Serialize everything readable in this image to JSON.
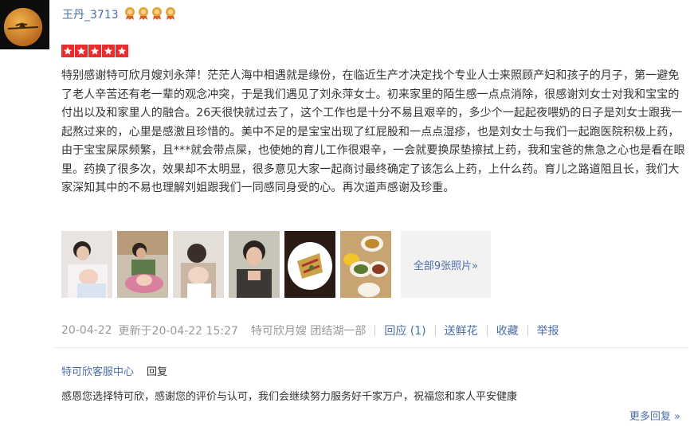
{
  "user": {
    "name": "王丹_3713",
    "badge_count": 4
  },
  "rating": {
    "stars": 5,
    "max": 5
  },
  "review": {
    "text": "特别感谢特可欣月嫂刘永萍！茫茫人海中相遇就是缘份，在临近生产才决定找个专业人士来照顾产妇和孩子的月子，第一避免了老人辛苦还有老一辈的观念冲突，于是我们遇见了刘永萍女士。初来家里的陌生感一点点消除，很感谢刘女士对我和宝宝的付出以及和家里人的融合。26天很快就过去了，这个工作也是十分不易且艰辛的，多少个一起起夜喂奶的日子是刘女士跟我一起熬过来的，心里是感激且珍惜的。美中不足的是宝宝出现了红屁股和一点点湿疹，也是刘女士与我们一起跑医院积极上药，由于宝宝屎尿频繁，且***就会带点屎，也使她的育儿工作很艰辛，一会就要换尿垫擦拭上药，我和宝爸的焦急之心也是看在眼里。药换了很多次，效果却不太明显，很多意见大家一起商讨最终确定了该怎么上药，上什么药。育儿之路道阻且长，我们大家深知其中的不易也理解刘姐跟我们一同感同身受的心。再次道声感谢及珍重。"
  },
  "photos": {
    "items": [
      {
        "icon": "photo-mother-baby"
      },
      {
        "icon": "photo-bathing-baby"
      },
      {
        "icon": "photo-holding-baby"
      },
      {
        "icon": "photo-selfie"
      },
      {
        "icon": "photo-food-dish"
      },
      {
        "icon": "photo-meal-table"
      }
    ],
    "more_label": "全部9张照片»"
  },
  "meta": {
    "date": "20-04-22",
    "updated": "更新于20-04-22 15:27",
    "service": "特可欣月嫂 团结湖一部",
    "reply_label": "回应",
    "reply_count": "(1)",
    "flower_label": "送鲜花",
    "favorite_label": "收藏",
    "report_label": "举报"
  },
  "reply": {
    "author": "特可欣客服中心",
    "label": "回复",
    "text": "感恩您选择特可欣，感谢您的评价与认可，我们会继续努力服务好千家万户，祝福您和家人平安健康",
    "more_label": "更多回复 »"
  },
  "colors": {
    "link": "#4a6ea8",
    "star": "#e62e2e",
    "muted": "#999999",
    "badge": "#e8a23a"
  }
}
